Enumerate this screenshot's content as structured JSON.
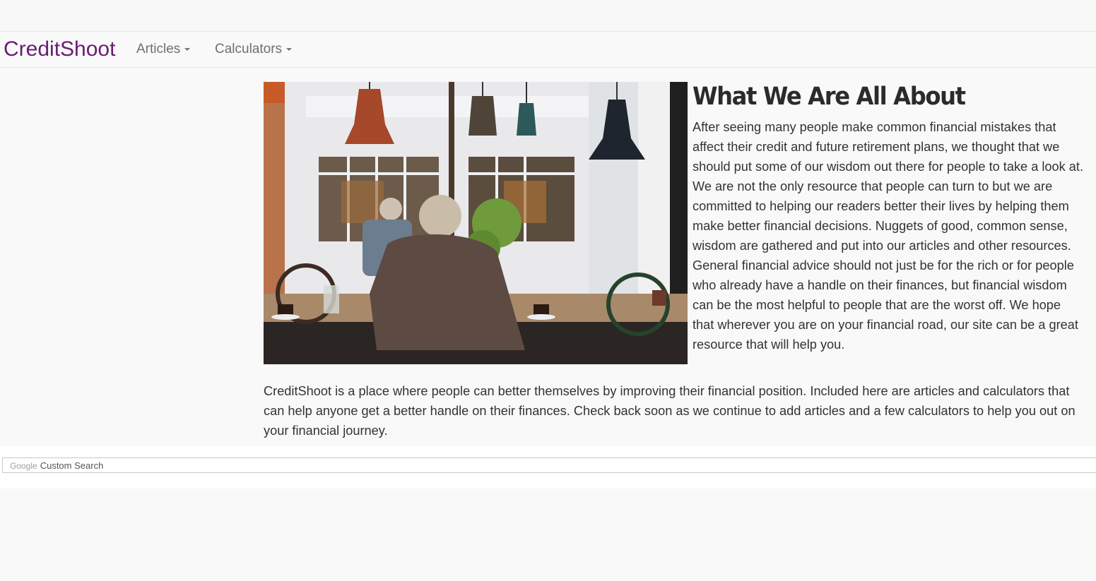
{
  "navbar": {
    "brand": "CreditShoot",
    "brand_color": "#6a1b74",
    "items": [
      {
        "label": "Articles",
        "icon": "caret-down-icon"
      },
      {
        "label": "Calculators",
        "icon": "caret-down-icon"
      }
    ]
  },
  "about": {
    "heading": "What We Are All About",
    "body": "After seeing many people make common financial mistakes that affect their credit and future retirement plans, we thought that we should put some of our wisdom out there for people to take a look at. We are not the only resource that people can turn to but we are committed to helping our readers better their lives by helping them make better financial decisions. Nuggets of good, common sense, wisdom are gathered and put into our articles and other resources. General financial advice should not just be for the rich or for people who already have a handle on their finances, but financial wisdom can be the most helpful to people that are the worst off. We hope that wherever you are on your financial road, our site can be a great resource that will help you."
  },
  "intro": {
    "body": "CreditShoot is a place where people can better themselves by improving their financial position. Included here are articles and calculators that can help anyone get a better handle on their finances. Check back soon as we continue to add articles and a few calculators to help you out on your financial journey."
  },
  "search": {
    "brand": "Google",
    "placeholder": "Custom Search"
  }
}
